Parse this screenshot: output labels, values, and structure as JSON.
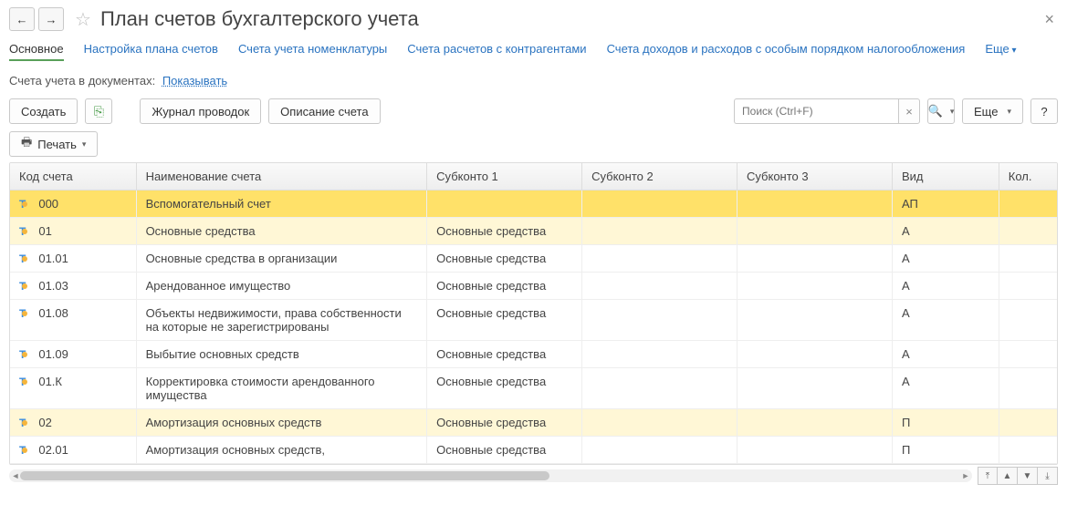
{
  "title": "План счетов бухгалтерского учета",
  "tabs": {
    "main": "Основное",
    "plan": "Настройка плана счетов",
    "nomen": "Счета учета номенклатуры",
    "contr": "Счета расчетов с контрагентами",
    "tax": "Счета доходов и расходов с особым порядком налогообложения",
    "more": "Еще"
  },
  "filter": {
    "label": "Счета учета в документах:",
    "value": "Показывать"
  },
  "toolbar": {
    "create": "Создать",
    "journal": "Журнал проводок",
    "descr": "Описание счета",
    "search_placeholder": "Поиск (Ctrl+F)",
    "more": "Еще",
    "print": "Печать"
  },
  "columns": {
    "code": "Код счета",
    "name": "Наименование счета",
    "sub1": "Субконто 1",
    "sub2": "Субконто 2",
    "sub3": "Субконто 3",
    "vid": "Вид",
    "kol": "Кол."
  },
  "rows": [
    {
      "code": "000",
      "name": "Вспомогательный счет",
      "sub1": "",
      "vid": "АП",
      "sel": true
    },
    {
      "code": "01",
      "name": "Основные средства",
      "sub1": "Основные средства",
      "vid": "А",
      "hl": true
    },
    {
      "code": "01.01",
      "name": "Основные средства в организации",
      "sub1": "Основные средства",
      "vid": "А"
    },
    {
      "code": "01.03",
      "name": "Арендованное имущество",
      "sub1": "Основные средства",
      "vid": "А"
    },
    {
      "code": "01.08",
      "name": "Объекты недвижимости, права собственности на которые не зарегистрированы",
      "sub1": "Основные средства",
      "vid": "А"
    },
    {
      "code": "01.09",
      "name": "Выбытие основных средств",
      "sub1": "Основные средства",
      "vid": "А"
    },
    {
      "code": "01.К",
      "name": "Корректировка стоимости арендованного имущества",
      "sub1": "Основные средства",
      "vid": "А"
    },
    {
      "code": "02",
      "name": "Амортизация основных средств",
      "sub1": "Основные средства",
      "vid": "П",
      "hl": true
    },
    {
      "code": "02.01",
      "name": "Амортизация основных средств,",
      "sub1": "Основные средства",
      "vid": "П"
    }
  ]
}
